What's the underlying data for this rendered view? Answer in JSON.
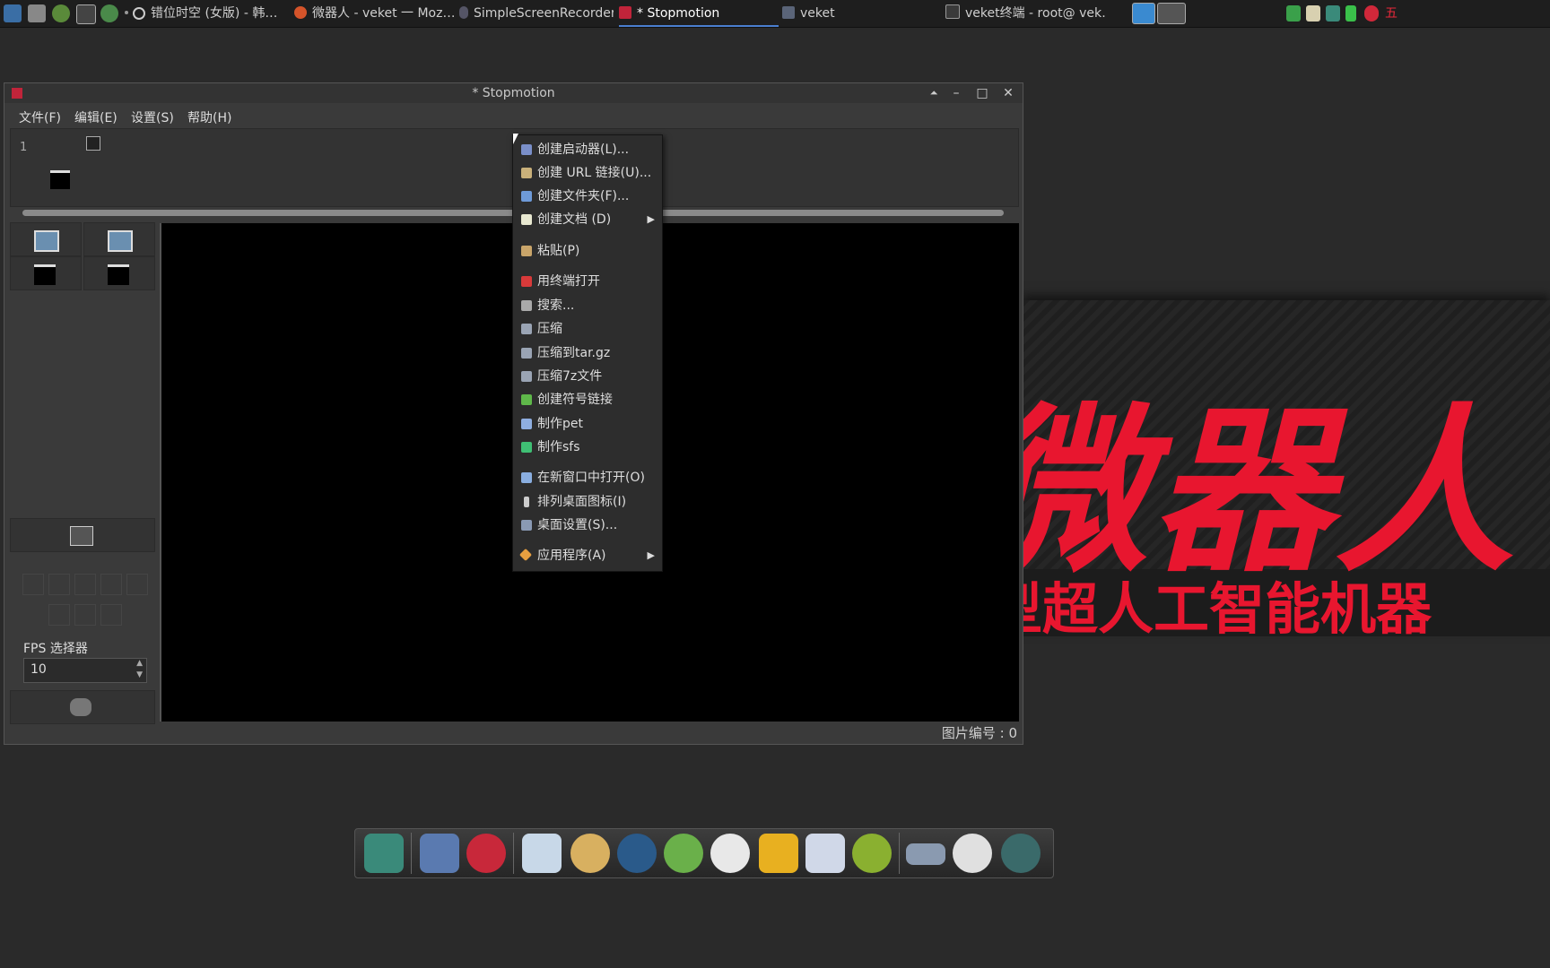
{
  "taskbar": {
    "tasks": [
      {
        "label": "错位时空 (女版) - 韩…",
        "icon": "music-player-icon"
      },
      {
        "label": "微器人 - veket 一 Moz…",
        "icon": "firefox-icon"
      },
      {
        "label": "SimpleScreenRecorder",
        "icon": "recorder-icon"
      },
      {
        "label": "* Stopmotion",
        "icon": "stopmotion-icon",
        "active": true
      },
      {
        "label": "veket",
        "icon": "folder-icon"
      },
      {
        "label": "veket终端 - root@ vek…",
        "icon": "terminal-icon"
      }
    ],
    "tray_trailing_text": "五"
  },
  "wallpaper": {
    "big_text": "微器人",
    "sub_text": "型超人工智能机器"
  },
  "window": {
    "title": "* Stopmotion",
    "menu": [
      "文件(F)",
      "编辑(E)",
      "设置(S)",
      "帮助(H)"
    ],
    "frame_number": "1",
    "fps_label": "FPS 选择器",
    "fps_value": "10",
    "status": "图片编号 : 0"
  },
  "context_menu": {
    "items": [
      {
        "label": "创建启动器(L)...",
        "icon": "launcher-icon",
        "color": "#7a8fc9"
      },
      {
        "label": "创建 URL 链接(U)...",
        "icon": "url-link-icon",
        "color": "#c9b07a"
      },
      {
        "label": "创建文件夹(F)...",
        "icon": "folder-icon",
        "color": "#6e9ad8"
      },
      {
        "label": "创建文档 (D)",
        "icon": "document-icon",
        "color": "#e8e8d0",
        "submenu": true
      },
      {
        "label": "粘贴(P)",
        "icon": "paste-icon",
        "color": "#c9a56a"
      },
      {
        "label": "用终端打开",
        "icon": "terminal-icon",
        "color": "#d83a3a"
      },
      {
        "label": "搜索...",
        "icon": "search-icon",
        "color": "#aaaaaa"
      },
      {
        "label": "压缩",
        "icon": "archive-icon",
        "color": "#9aa4b4"
      },
      {
        "label": "压缩到tar.gz",
        "icon": "archive-icon",
        "color": "#9aa4b4"
      },
      {
        "label": "压缩7z文件",
        "icon": "archive-icon",
        "color": "#9aa4b4"
      },
      {
        "label": "创建符号链接",
        "icon": "symlink-icon",
        "color": "#5fb84a"
      },
      {
        "label": "制作pet",
        "icon": "pet-icon",
        "color": "#8faee0"
      },
      {
        "label": "制作sfs",
        "icon": "sfs-icon",
        "color": "#3fbf74"
      },
      {
        "label": "在新窗口中打开(O)",
        "icon": "new-window-icon",
        "color": "#8aaee0"
      },
      {
        "label": "排列桌面图标(I)",
        "icon": "arrange-icon",
        "color": "#cccccc"
      },
      {
        "label": "桌面设置(S)...",
        "icon": "desktop-settings-icon",
        "color": "#8a9ab4"
      },
      {
        "label": "应用程序(A)",
        "icon": "applications-icon",
        "color": "#e8a040",
        "submenu": true
      }
    ]
  },
  "dock": {
    "icons": [
      "files-icon",
      "monitor-icon",
      "squirrel-icon",
      "notepad-icon",
      "paint-icon",
      "media-icon",
      "chat-icon",
      "penguin-icon",
      "notebook-icon",
      "chart-icon",
      "help-icon",
      "drive-icon",
      "brightness-icon",
      "browser-icon"
    ]
  }
}
